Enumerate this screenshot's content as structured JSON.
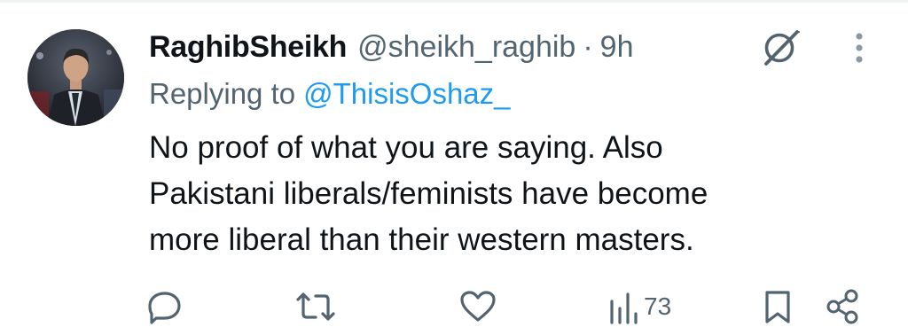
{
  "tweet": {
    "display_name": "RaghibSheikh",
    "handle": "@sheikh_raghib",
    "separator": "·",
    "time": "9h",
    "reply_prefix": "Replying to",
    "reply_to": "@ThisisOshaz_",
    "body_lines": [
      "No proof of what you are saying. Also",
      "Pakistani liberals/feminists have become",
      "more liberal than their western masters."
    ]
  },
  "actions": {
    "reply": {
      "icon": "reply-icon"
    },
    "repost": {
      "icon": "repost-icon"
    },
    "like": {
      "icon": "heart-icon"
    },
    "views": {
      "icon": "views-icon",
      "count": "73"
    },
    "bookmark": {
      "icon": "bookmark-icon"
    },
    "share": {
      "icon": "share-icon"
    }
  },
  "colors": {
    "text_primary": "#0f1419",
    "text_secondary": "#536471",
    "link": "#1d9bf0",
    "icon": "#536471"
  }
}
